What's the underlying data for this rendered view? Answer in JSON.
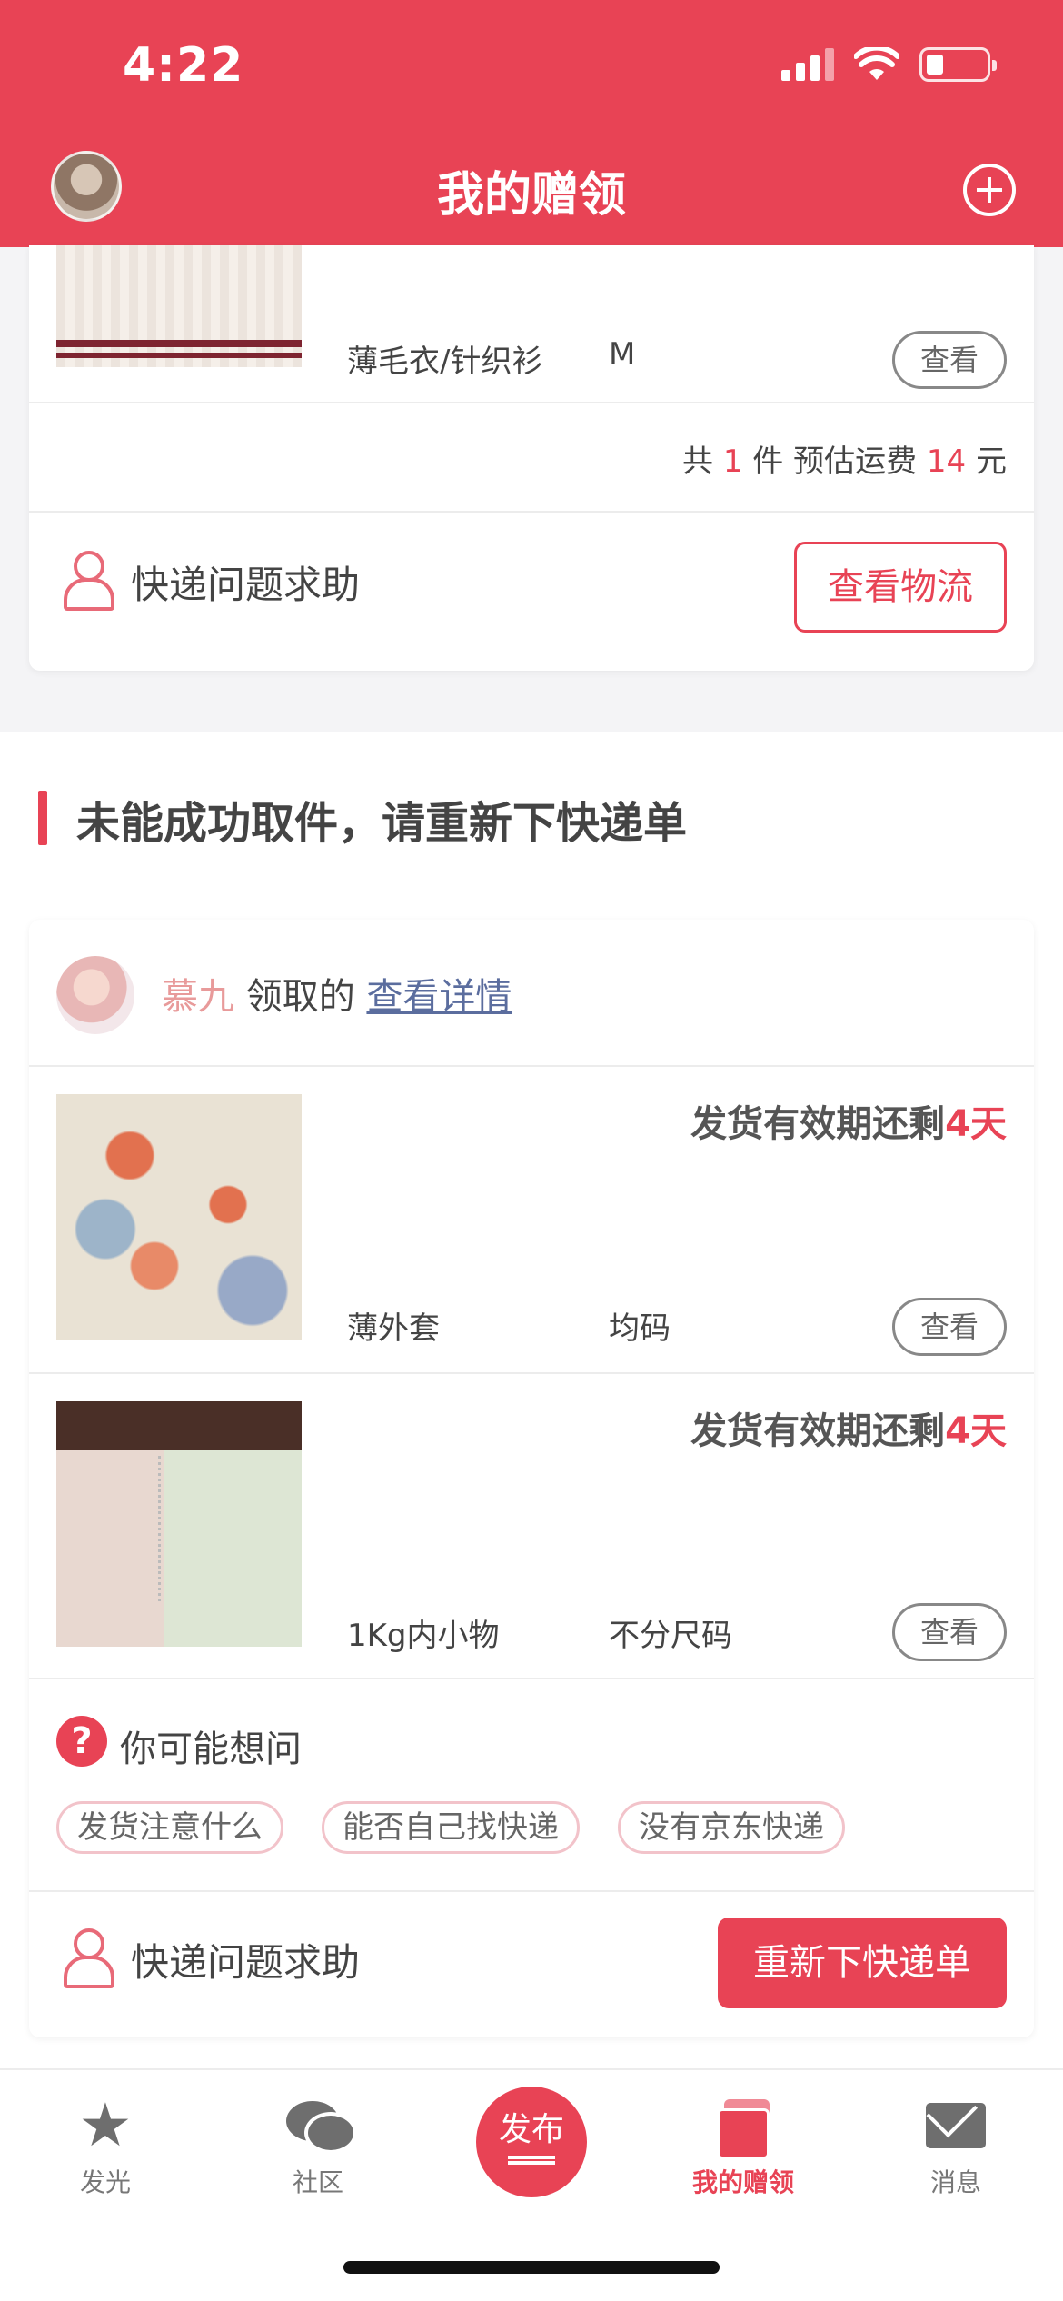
{
  "status": {
    "time": "4:22"
  },
  "header": {
    "title": "我的赠领"
  },
  "card1": {
    "item": {
      "name": "薄毛衣/针织衫",
      "size": "M",
      "view_label": "查看"
    },
    "summary": {
      "prefix": "共",
      "count": "1",
      "unit": "件 预估运费",
      "fee": "14",
      "currency": "元"
    },
    "help_label": "快递问题求助",
    "logistics_button": "查看物流"
  },
  "section": {
    "title": "未能成功取件，请重新下快递单"
  },
  "card2": {
    "giver": {
      "name": "慕九",
      "suffix": "领取的",
      "detail_link": "查看详情"
    },
    "items": [
      {
        "deadline_prefix": "发货有效期还剩",
        "deadline_days": "4天",
        "name": "薄外套",
        "size": "均码",
        "view_label": "查看"
      },
      {
        "deadline_prefix": "发货有效期还剩",
        "deadline_days": "4天",
        "name": "1Kg内小物",
        "size": "不分尺码",
        "view_label": "查看"
      }
    ],
    "faq": {
      "title": "你可能想问",
      "icon": "?",
      "chips": [
        "发货注意什么",
        "能否自己找快递",
        "没有京东快递"
      ]
    },
    "help_label": "快递问题求助",
    "reorder_button": "重新下快递单"
  },
  "tabbar": {
    "tabs": [
      {
        "label": "发光",
        "icon": "star-icon"
      },
      {
        "label": "社区",
        "icon": "chat-icon"
      },
      {
        "label": "我的赠领",
        "icon": "gift-icon"
      },
      {
        "label": "消息",
        "icon": "mail-icon"
      }
    ],
    "publish_label": "发布",
    "active_color": "#e84355"
  }
}
